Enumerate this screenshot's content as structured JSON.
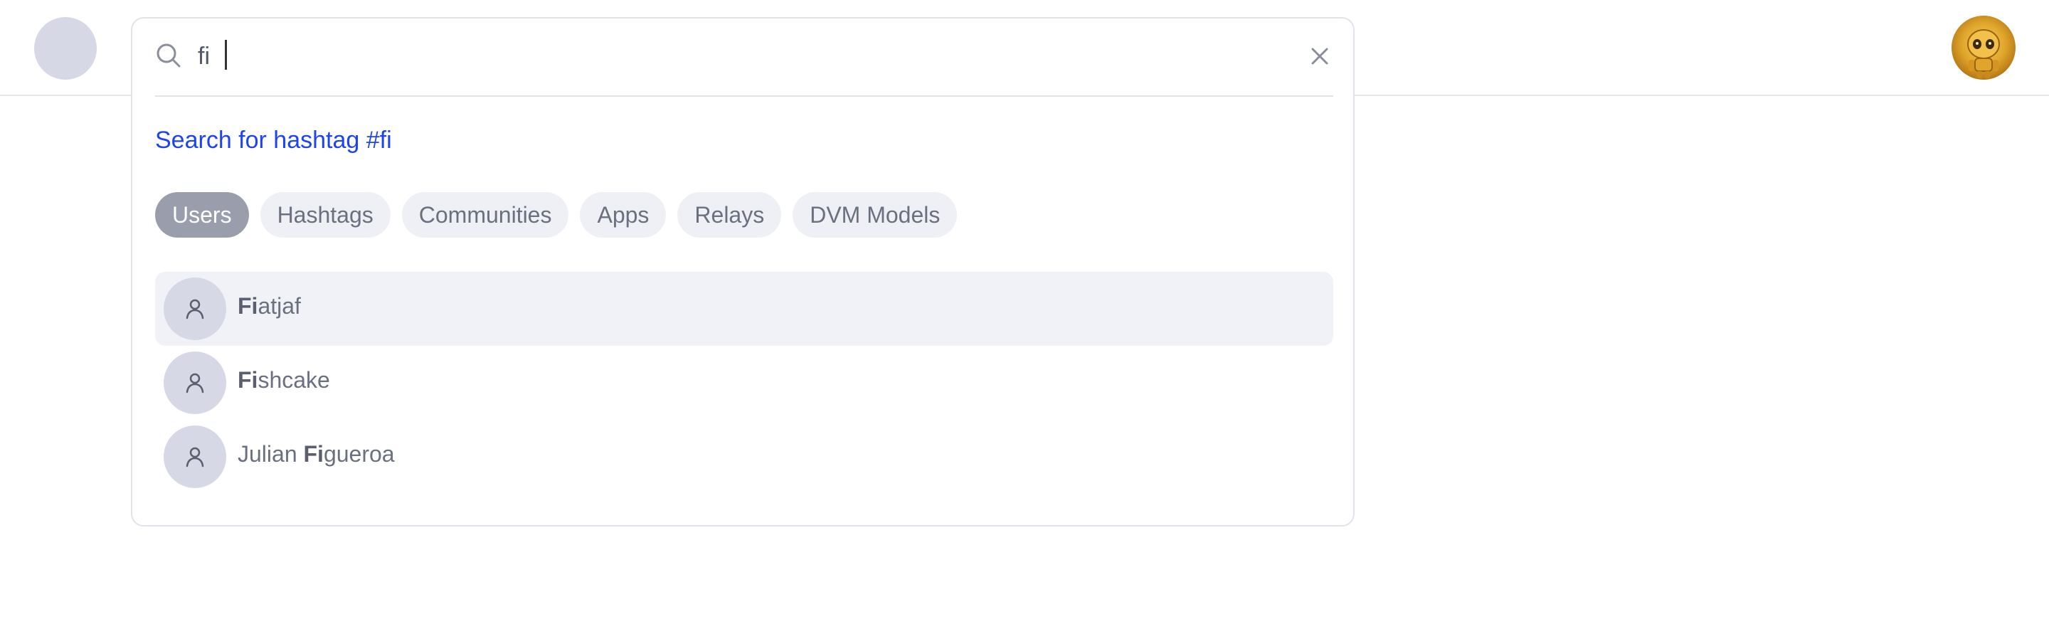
{
  "search": {
    "value": "fi",
    "hashtag_link": "Search for hashtag #fi"
  },
  "tabs": [
    {
      "label": "Users",
      "active": true
    },
    {
      "label": "Hashtags",
      "active": false
    },
    {
      "label": "Communities",
      "active": false
    },
    {
      "label": "Apps",
      "active": false
    },
    {
      "label": "Relays",
      "active": false
    },
    {
      "label": "DVM Models",
      "active": false
    }
  ],
  "results": [
    {
      "prefix": "",
      "match": "Fi",
      "suffix": "atjaf",
      "highlighted": true
    },
    {
      "prefix": "",
      "match": "Fi",
      "suffix": "shcake",
      "highlighted": false
    },
    {
      "prefix": "Julian ",
      "match": "Fi",
      "suffix": "gueroa",
      "highlighted": false
    }
  ],
  "icons": {
    "search": "search-icon",
    "clear": "close-icon",
    "user": "user-icon"
  },
  "colors": {
    "link": "#1d44f0",
    "active_tab": "#9a9dab",
    "tab": "#eef0f5",
    "highlight_row": "#f1f2f8"
  }
}
